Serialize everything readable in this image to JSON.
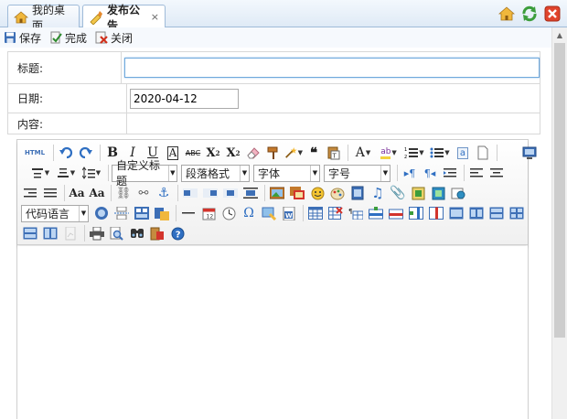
{
  "tabs": [
    {
      "label": "我的桌面",
      "icon": "home-icon",
      "active": false
    },
    {
      "label": "发布公告",
      "icon": "announcement-icon",
      "active": true,
      "close": "×"
    }
  ],
  "window_controls": {
    "home": "home-icon",
    "refresh": "refresh-icon",
    "close": "close-icon"
  },
  "actions": {
    "save": "保存",
    "finish": "完成",
    "close": "关闭"
  },
  "form": {
    "title_label": "标题:",
    "title_value": "",
    "date_label": "日期:",
    "date_value": "2020-04-12",
    "content_label": "内容:"
  },
  "editor": {
    "html_label": "HTML",
    "combos": {
      "custom_title": "自定义标题",
      "paragraph": "段落格式",
      "font": "字体",
      "size": "字号",
      "code_lang": "代码语言"
    }
  },
  "colors": {
    "accent": "#6fa8dc",
    "tab_border": "#9fbbd9",
    "close_red": "#e0442c",
    "refresh_green": "#3c9d3c"
  }
}
